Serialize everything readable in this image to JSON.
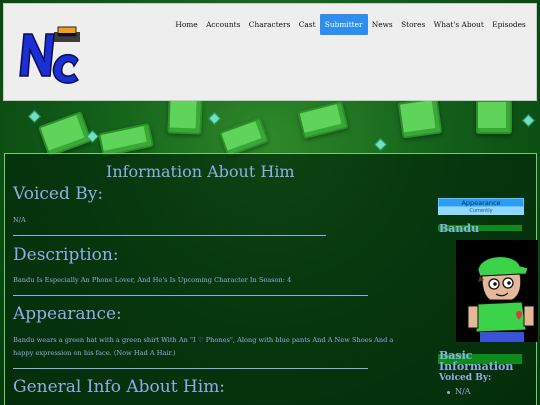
{
  "site": {
    "logo_text": "NC",
    "logo_icon": "hat-logo-icon"
  },
  "nav": {
    "items": [
      "Home",
      "Accounts",
      "Characters",
      "Cast",
      "Submitter",
      "News",
      "Stores",
      "What's About",
      "Episodes"
    ],
    "active": "Submitter"
  },
  "main": {
    "title": "Information About Him",
    "voiced_by": {
      "heading": "Voiced By:",
      "text": "N/A"
    },
    "description": {
      "heading": "Description:",
      "text": "Bandu Is Especially An Phone Lover, And He's Is Upcoming Character In Season: 4"
    },
    "appearance": {
      "heading": "Appearance:",
      "text_line1": "Bandu wears a green hat with a green shirt With An \"I ♡ Phones\", Along with blue pants And A New Shoes And a",
      "text_line2": "happy expression on his face. (Now Had A Hair.)"
    },
    "general": {
      "heading": "General Info About Him:"
    }
  },
  "sidebar": {
    "tab_label": "Appearance",
    "tab_sub": "Currently",
    "character_name": "Bandu",
    "basic_title": "Basic Information",
    "voiced_by_label": "Voiced By:",
    "voiced_by_value": "N/A"
  },
  "colors": {
    "text": "#8faee8",
    "accent_bar": "#0e8a1c",
    "active_nav": "#2d8ef0",
    "header_bg": "#eeeeee"
  }
}
